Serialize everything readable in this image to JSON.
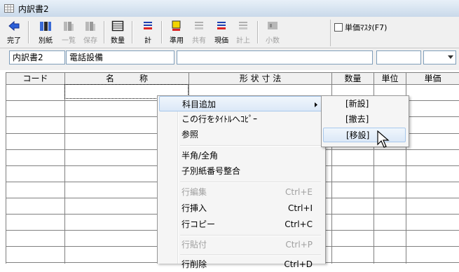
{
  "window": {
    "title": "内訳書2"
  },
  "toolbar": {
    "buttons": [
      {
        "label": "完了",
        "icon": "back-arrow-icon",
        "enabled": true
      },
      {
        "label": "別紙",
        "icon": "columns-icon",
        "enabled": true
      },
      {
        "label": "一覧",
        "icon": "columns-icon",
        "enabled": false
      },
      {
        "label": "保存",
        "icon": "columns-icon",
        "enabled": false
      },
      {
        "label": "数量",
        "icon": "table-icon",
        "enabled": true
      },
      {
        "label": "計",
        "icon": "lines-icon",
        "enabled": true
      },
      {
        "label": "準用",
        "icon": "yellow-square-icon",
        "enabled": true
      },
      {
        "label": "共有",
        "icon": "lines-icon",
        "enabled": false
      },
      {
        "label": "現価",
        "icon": "lines-icon",
        "enabled": true
      },
      {
        "label": "計上",
        "icon": "lines-icon",
        "enabled": false
      },
      {
        "label": "小数",
        "icon": "decimal-icon",
        "enabled": false
      }
    ],
    "master_label": "単価ﾏｽﾀ(F7)",
    "master_checked": false
  },
  "info": {
    "sheet_name": "内訳書2",
    "item_name": "電話設備",
    "description": "",
    "right_field": "",
    "right_select": ""
  },
  "grid": {
    "columns": [
      "コード",
      "名　　　称",
      "形 状 寸 法",
      "数量",
      "単位",
      "単価"
    ]
  },
  "context_menu": {
    "items": [
      {
        "label": "科目追加",
        "shortcut": "",
        "enabled": true,
        "submenu": true
      },
      {
        "label": "この行をﾀｲﾄﾙへｺﾋﾟｰ",
        "shortcut": "",
        "enabled": true
      },
      {
        "label": "参照",
        "shortcut": "",
        "enabled": true
      },
      {
        "label": "半角/全角",
        "shortcut": "",
        "enabled": true
      },
      {
        "label": "子別紙番号整合",
        "shortcut": "",
        "enabled": true
      },
      {
        "label": "行編集",
        "shortcut": "Ctrl+E",
        "enabled": false
      },
      {
        "label": "行挿入",
        "shortcut": "Ctrl+I",
        "enabled": true
      },
      {
        "label": "行コピー",
        "shortcut": "Ctrl+C",
        "enabled": true
      },
      {
        "label": "行貼付",
        "shortcut": "Ctrl+P",
        "enabled": false
      },
      {
        "label": "行削除",
        "shortcut": "Ctrl+D",
        "enabled": true
      }
    ]
  },
  "submenu": {
    "items": [
      "[新設]",
      "[撤去]",
      "[移設]"
    ]
  },
  "colors": {
    "highlight": "#dbe8f7",
    "highlight_border": "#a8c8ec",
    "disabled_text": "#a0a0a0"
  }
}
